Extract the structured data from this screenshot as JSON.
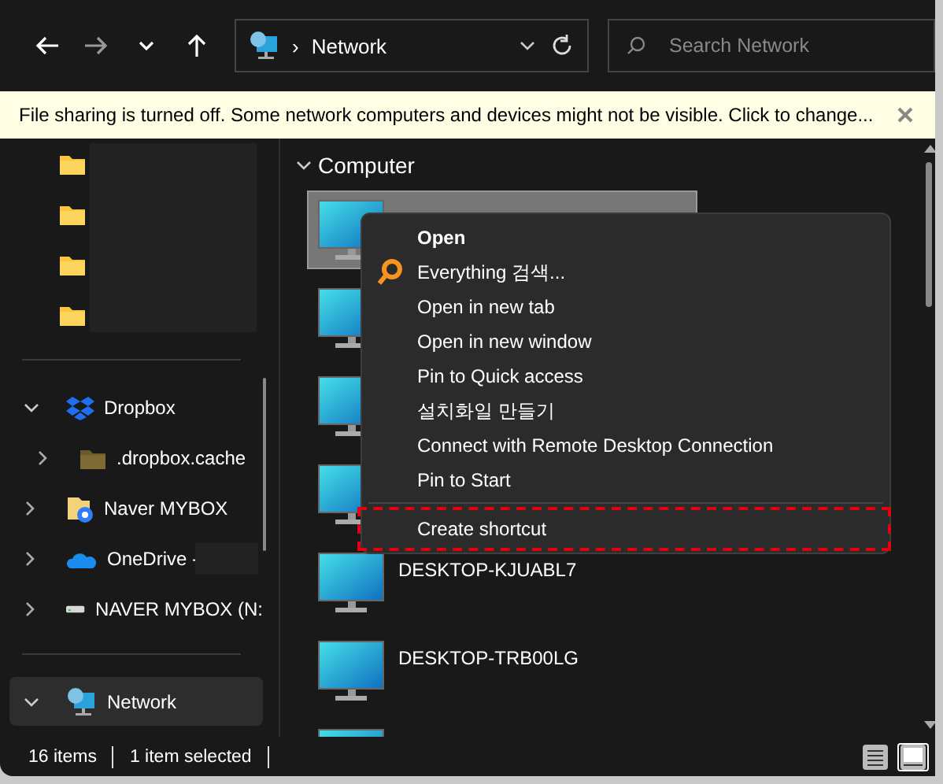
{
  "toolbar": {
    "address": {
      "separator": "›",
      "location": "Network"
    },
    "search": {
      "placeholder": "Search Network"
    }
  },
  "infobar": {
    "message": "File sharing is turned off. Some network computers and devices might not be visible. Click to change..."
  },
  "sidebar": {
    "quick_access": {
      "redacted": true,
      "items": [
        {
          "kind": "folder"
        },
        {
          "kind": "folder"
        },
        {
          "kind": "folder"
        },
        {
          "kind": "folder"
        }
      ]
    },
    "tree": [
      {
        "label": "Dropbox",
        "kind": "dropbox",
        "expanded": true,
        "selected": false,
        "children": [
          {
            "label": ".dropbox.cache",
            "kind": "folder-dim",
            "expanded": false,
            "selected": false
          }
        ]
      },
      {
        "label": "Naver MYBOX",
        "kind": "cloud-folder",
        "expanded": false,
        "selected": false
      },
      {
        "label": "OneDrive -",
        "kind": "onedrive",
        "expanded": false,
        "selected": false,
        "redacted": true
      },
      {
        "label": "NAVER MYBOX (N:",
        "kind": "drive",
        "expanded": false,
        "selected": false
      }
    ],
    "network": {
      "label": "Network",
      "kind": "network",
      "expanded": true,
      "selected": true
    }
  },
  "content": {
    "group": {
      "label": "Computer",
      "expanded": true
    },
    "items": [
      {
        "selected": true
      },
      {
        "selected": false
      },
      {
        "selected": false
      },
      {
        "selected": false
      },
      {
        "label": "DESKTOP-KJUABL7",
        "selected": false
      },
      {
        "label": "DESKTOP-TRB00LG",
        "selected": false
      },
      {
        "selected": false
      }
    ]
  },
  "context_menu": {
    "items": [
      {
        "kind": "item",
        "label": "Open",
        "default": true
      },
      {
        "kind": "icon-item",
        "label": "Everything 검색..."
      },
      {
        "kind": "item",
        "label": "Open in new tab"
      },
      {
        "kind": "item",
        "label": "Open in new window"
      },
      {
        "kind": "item",
        "label": "Pin to Quick access"
      },
      {
        "kind": "item",
        "label": "설치화일 만들기"
      },
      {
        "kind": "item",
        "label": "Connect with Remote Desktop Connection"
      },
      {
        "kind": "item",
        "label": "Pin to Start"
      },
      {
        "kind": "separator"
      },
      {
        "kind": "item",
        "label": "Create shortcut",
        "highlighted": true
      }
    ]
  },
  "status_bar": {
    "item_count": "16 items",
    "selection": "1 item selected",
    "views": [
      {
        "kind": "details",
        "selected": false
      },
      {
        "kind": "tiles",
        "selected": true
      }
    ]
  }
}
